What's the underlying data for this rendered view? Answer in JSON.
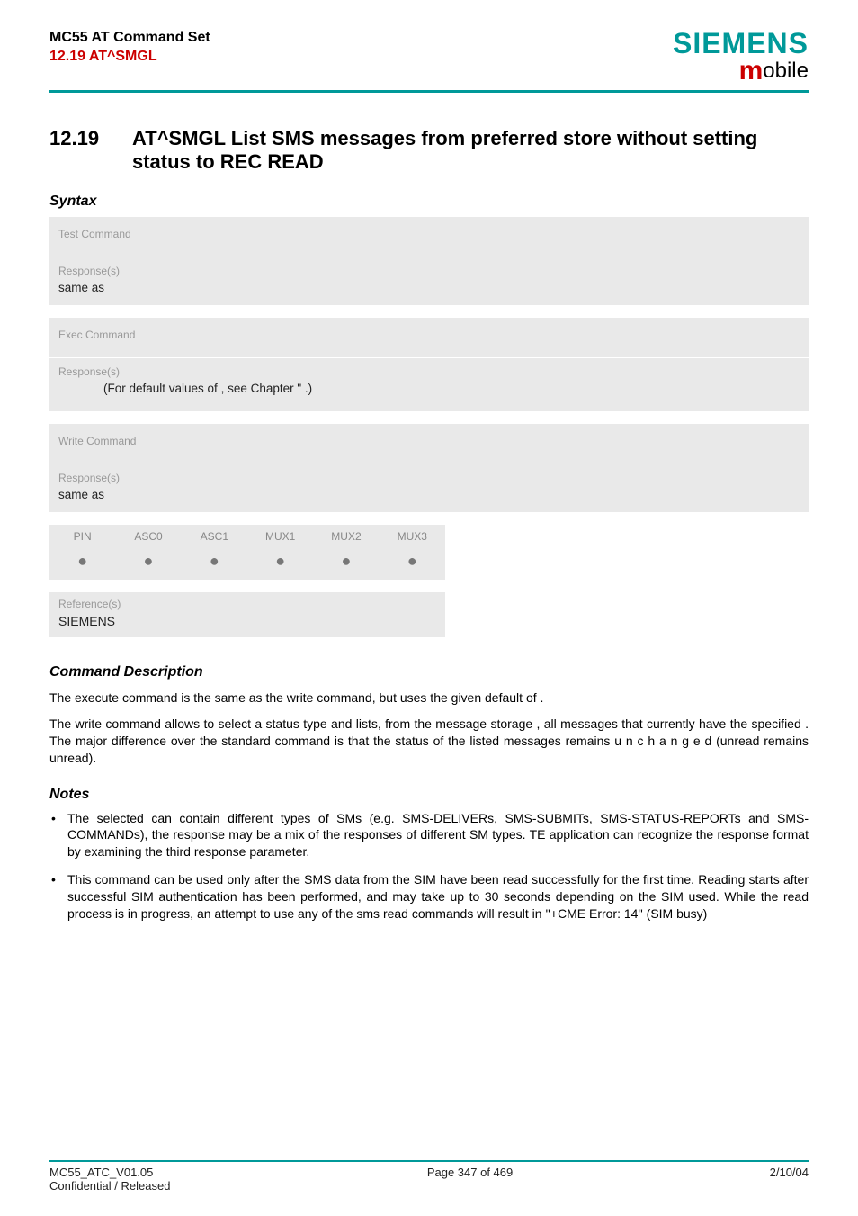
{
  "header": {
    "title_line1": "MC55 AT Command Set",
    "title_line2": "12.19 AT^SMGL",
    "logo_top": "SIEMENS",
    "logo_bottom_m": "m",
    "logo_bottom_rest": "obile"
  },
  "section": {
    "number": "12.19",
    "title": "AT^SMGL   List SMS messages from preferred store without setting status to REC READ"
  },
  "syntax_heading": "Syntax",
  "test_box": {
    "label": "Test Command",
    "resp_label": "Response(s)",
    "resp_text": "same as"
  },
  "exec_box": {
    "label": "Exec Command",
    "resp_label": "Response(s)",
    "line": "(For default values of                      , see Chapter \"                                       .)"
  },
  "write_box": {
    "label": "Write Command",
    "resp_label": "Response(s)",
    "resp_text": "same as"
  },
  "compat": {
    "cols": [
      "PIN",
      "ASC0",
      "ASC1",
      "MUX1",
      "MUX2",
      "MUX3"
    ],
    "dot": "●"
  },
  "reference": {
    "label": "Reference(s)",
    "value": "SIEMENS"
  },
  "cmd_desc": {
    "heading": "Command Description",
    "p1": "The execute command is the same as the write command, but uses the given default of               .",
    "p2": "The write command allows to select a status type and lists, from the message storage              , all messages that currently have the specified               . The major difference over the standard command                 is that the status of the listed messages remains u n c h a n g e d (unread remains unread)."
  },
  "notes": {
    "heading": "Notes",
    "items": [
      "The selected                 can contain different types of SMs (e.g. SMS-DELIVERs, SMS-SUBMITs, SMS-STATUS-REPORTs and SMS-COMMANDs), the response may be a mix of the responses of different SM types. TE application can recognize the response format by examining the third response parameter.",
      "This command can be used only after the SMS data from the SIM have been read successfully for the first time. Reading starts after successful SIM authentication has been performed, and may take up to 30 seconds depending on the SIM used. While the read process is in progress, an attempt to use any of the sms read commands will result in ''+CME Error: 14'' (SIM busy)"
    ]
  },
  "footer": {
    "left1": "MC55_ATC_V01.05",
    "left2": "Confidential / Released",
    "center": "Page 347 of 469",
    "right": "2/10/04"
  }
}
